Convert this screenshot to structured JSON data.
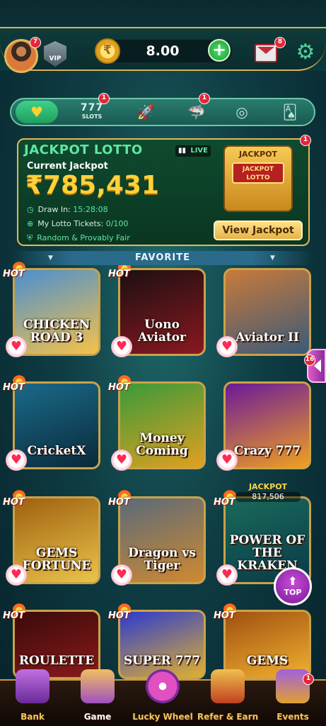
{
  "header": {
    "avatar_badge": "7",
    "vip_label": "VIP",
    "balance": "8.00",
    "add_symbol": "+",
    "mail_badge": "8",
    "settings_icon": "gear-icon"
  },
  "tabs": {
    "favorite_icon": "heart-icon",
    "slots_number": "777",
    "slots_label": "SLOTS",
    "slots_badge": "1",
    "shark_badge": "1"
  },
  "lotto": {
    "title": "JACKPOT LOTTO",
    "live_label": "LIVE",
    "current_label": "Current Jackpot",
    "amount": "₹785,431",
    "draw_label": "Draw In:",
    "draw_value": "15:28:08",
    "tickets_label": "My Lotto Tickets:",
    "tickets_value": "0/100",
    "fair_label": "Random & Provably Fair",
    "machine_top": "JACKPOT",
    "machine_screen": "JACKPOT LOTTO",
    "view_button": "View Jackpot",
    "badge": "1"
  },
  "favorite": {
    "title": "FAVORITE"
  },
  "games": [
    {
      "title": "CHICKEN ROAD 3",
      "hot": "HOT",
      "colors": [
        "#4a8fd0",
        "#f5c24a"
      ]
    },
    {
      "title": "Uono Aviator",
      "hot": "HOT",
      "colors": [
        "#1c1012",
        "#8a1820"
      ]
    },
    {
      "title": "Aviator II",
      "hot": "",
      "colors": [
        "#c97a3a",
        "#3a5a7a"
      ]
    },
    {
      "title": "CricketX",
      "hot": "HOT",
      "colors": [
        "#1a6a8a",
        "#0a2a3a"
      ]
    },
    {
      "title": "Money Coming",
      "hot": "HOT",
      "colors": [
        "#3a9a3a",
        "#e0a020"
      ]
    },
    {
      "title": "Crazy 777",
      "hot": "",
      "colors": [
        "#6a1a9a",
        "#f0a020"
      ]
    },
    {
      "title": "GEMS FORTUNE",
      "hot": "HOT",
      "colors": [
        "#a06010",
        "#e9c44a"
      ]
    },
    {
      "title": "Dragon vs Tiger",
      "hot": "HOT",
      "colors": [
        "#5a6a7a",
        "#d08a30"
      ]
    },
    {
      "title": "POWER OF THE KRAKEN",
      "hot": "HOT",
      "colors": [
        "#1a6a5a",
        "#0a3a4a"
      ]
    },
    {
      "title": "ROULETTE",
      "hot": "HOT",
      "colors": [
        "#3a0a0a",
        "#8a1a1a"
      ]
    },
    {
      "title": "SUPER 777",
      "hot": "HOT",
      "colors": [
        "#2a3ad0",
        "#e0b030"
      ]
    },
    {
      "title": "GEMS",
      "hot": "HOT",
      "colors": [
        "#a05010",
        "#f0b030"
      ]
    }
  ],
  "kraken_jackpot": {
    "label": "JACKPOT",
    "value": "817,506"
  },
  "side_badge": "16",
  "top_button": {
    "arrow": "⬆",
    "label": "TOP"
  },
  "bottom_nav": {
    "bank": "Bank",
    "game": "Game",
    "lucky_wheel": "Lucky Wheel",
    "refer": "Refer & Earn",
    "events": "Events",
    "events_badge": "1"
  }
}
